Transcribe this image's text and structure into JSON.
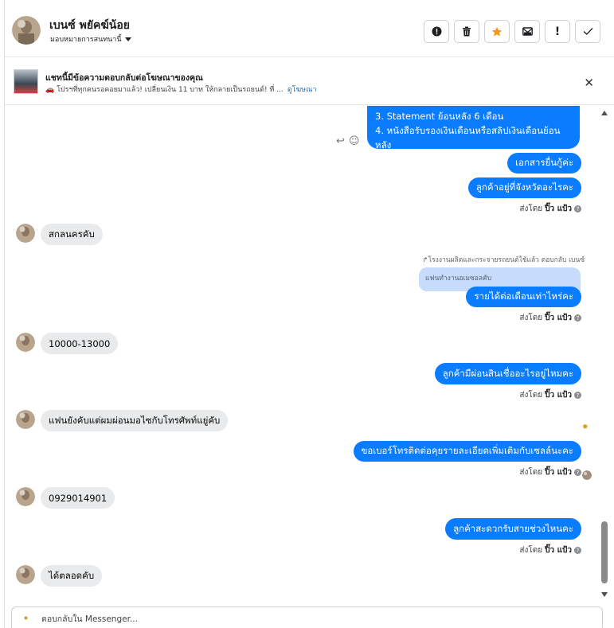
{
  "contact": {
    "name": "เบนซ์ พยัคฆ์น้อย",
    "subtitle": "มอบหมายการสนทนานี้"
  },
  "toolbar": {
    "buttons": [
      {
        "name": "alert-icon",
        "glyph": "❗"
      },
      {
        "name": "trash-icon",
        "glyph": "🗑"
      },
      {
        "name": "star-icon",
        "glyph": "★"
      },
      {
        "name": "mail-icon",
        "glyph": "✉"
      },
      {
        "name": "exclamation-icon",
        "glyph": "!"
      },
      {
        "name": "check-icon",
        "glyph": "✓"
      }
    ]
  },
  "ad": {
    "title": "แชทนี้มีข้อความตอบกลับต่อโฆษณาของคุณ",
    "description": "🚗 โปรฯที่ทุกคนรอคอยมาแล้ว! เปลี่ยนเงิน 11 บาท ให้กลายเป็นรถยนต์! ที่ ...",
    "link": "ดูโฆษณา",
    "close": "✕"
  },
  "messages": {
    "statement_line": "3. Statement ย้อนหลัง 6 เดือน",
    "salary_line": "4. หนังสือรับรองเงินเดือนหรือสลิปเงินเดือนย้อนหลัง",
    "m1": "เอกสารยื่นกู้ค่ะ",
    "m2": "ลูกค้าอยู่ที่จังหวัดอะไรคะ",
    "in1": "สกลนครคับ",
    "reply_meta": "โรงงานผลิตและกระจายรถยนต์ใช้แล้ว ตอบกลับ เบนซ์",
    "quoted": "แฟนทำงานอเมซอลคับ",
    "m3": "รายได้ต่อเดือนเท่าไหร่คะ",
    "in2": "10000-13000",
    "m4": "ลูกค้ามีผ่อนสินเชื่ออะไรอยู่ไหมคะ",
    "in3": "แฟนยังคับแต่ผมผ่อนมอไซกับโทรศัพท์แยู่คับ",
    "m5": "ขอเบอร์โทรติดต่อคุยรายละเอียดเพิ่มเติมกับเซลล์นะคะ",
    "in4": "0929014901",
    "m6": "ลูกค้าสะดวกรับสายช่วงไหนคะ",
    "in5": "ได้ตลอดคับ"
  },
  "sent_by": {
    "prefix": "ส่งโดย",
    "name": "ปิ๊ว แป้ว",
    "info": "?"
  },
  "composer": {
    "placeholder": "ตอบกลับใน Messenger...",
    "logo": "LOGO"
  },
  "colors": {
    "outgoing": "#0a7cff",
    "incoming": "#e9eaeb",
    "quoted": "#c7dcfb"
  }
}
